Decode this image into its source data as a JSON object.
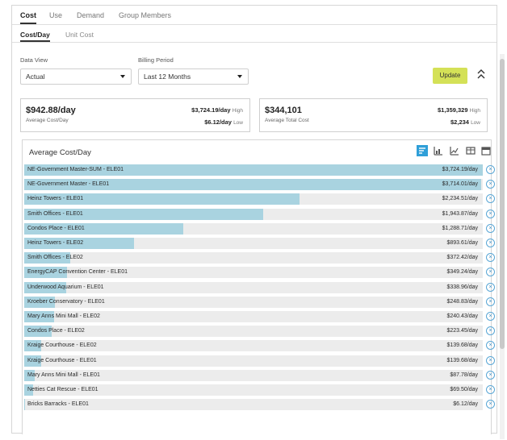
{
  "tabs": [
    {
      "label": "Cost",
      "active": true
    },
    {
      "label": "Use",
      "active": false
    },
    {
      "label": "Demand",
      "active": false
    },
    {
      "label": "Group Members",
      "active": false
    }
  ],
  "subtabs": [
    {
      "label": "Cost/Day",
      "active": true
    },
    {
      "label": "Unit Cost",
      "active": false
    }
  ],
  "filters": {
    "data_view_label": "Data View",
    "data_view_value": "Actual",
    "billing_period_label": "Billing Period",
    "billing_period_value": "Last 12 Months",
    "update_label": "Update",
    "collapse_icon": "chevron-double-up-icon"
  },
  "cards": [
    {
      "value": "$942.88/day",
      "caption": "Average Cost/Day",
      "high_value": "$3,724.19/day",
      "high_tag": "High",
      "low_value": "$6.12/day",
      "low_tag": "Low"
    },
    {
      "value": "$344,101",
      "caption": "Average Total Cost",
      "high_value": "$1,359,329",
      "high_tag": "High",
      "low_value": "$2,234",
      "low_tag": "Low"
    }
  ],
  "list": {
    "title": "Average Cost/Day",
    "tools": [
      "sort-desc-icon",
      "bar-chart-icon",
      "line-chart-icon",
      "table-icon",
      "calendar-icon"
    ],
    "bar_color": "#a9d3e0",
    "max_value": 3724.19,
    "rows": [
      {
        "name": "NE-Government Master-SUM - ELE01",
        "label": "$3,724.19/day",
        "value": 3724.19
      },
      {
        "name": "NE-Government Master - ELE01",
        "label": "$3,714.01/day",
        "value": 3714.01
      },
      {
        "name": "Heinz Towers - ELE01",
        "label": "$2,234.51/day",
        "value": 2234.51
      },
      {
        "name": "Smith Offices - ELE01",
        "label": "$1,943.87/day",
        "value": 1943.87
      },
      {
        "name": "Condos Place - ELE01",
        "label": "$1,288.71/day",
        "value": 1288.71
      },
      {
        "name": "Heinz Towers - ELE02",
        "label": "$893.61/day",
        "value": 893.61
      },
      {
        "name": "Smith Offices - ELE02",
        "label": "$372.42/day",
        "value": 372.42
      },
      {
        "name": "EnergyCAP Convention Center - ELE01",
        "label": "$349.24/day",
        "value": 349.24
      },
      {
        "name": "Underwood Aquarium - ELE01",
        "label": "$338.96/day",
        "value": 338.96
      },
      {
        "name": "Kroeber Conservatory - ELE01",
        "label": "$248.83/day",
        "value": 248.83
      },
      {
        "name": "Mary Anns Mini Mall - ELE02",
        "label": "$240.43/day",
        "value": 240.43
      },
      {
        "name": "Condos Place - ELE02",
        "label": "$223.45/day",
        "value": 223.45
      },
      {
        "name": "Kraige Courthouse - ELE02",
        "label": "$139.68/day",
        "value": 139.68
      },
      {
        "name": "Kraige Courthouse - ELE01",
        "label": "$139.68/day",
        "value": 139.68
      },
      {
        "name": "Mary Anns Mini Mall - ELE01",
        "label": "$87.78/day",
        "value": 87.78
      },
      {
        "name": "Netties Cat Rescue - ELE01",
        "label": "$69.50/day",
        "value": 69.5
      },
      {
        "name": "Bricks Barracks - ELE01",
        "label": "$6.12/day",
        "value": 6.12
      }
    ]
  }
}
